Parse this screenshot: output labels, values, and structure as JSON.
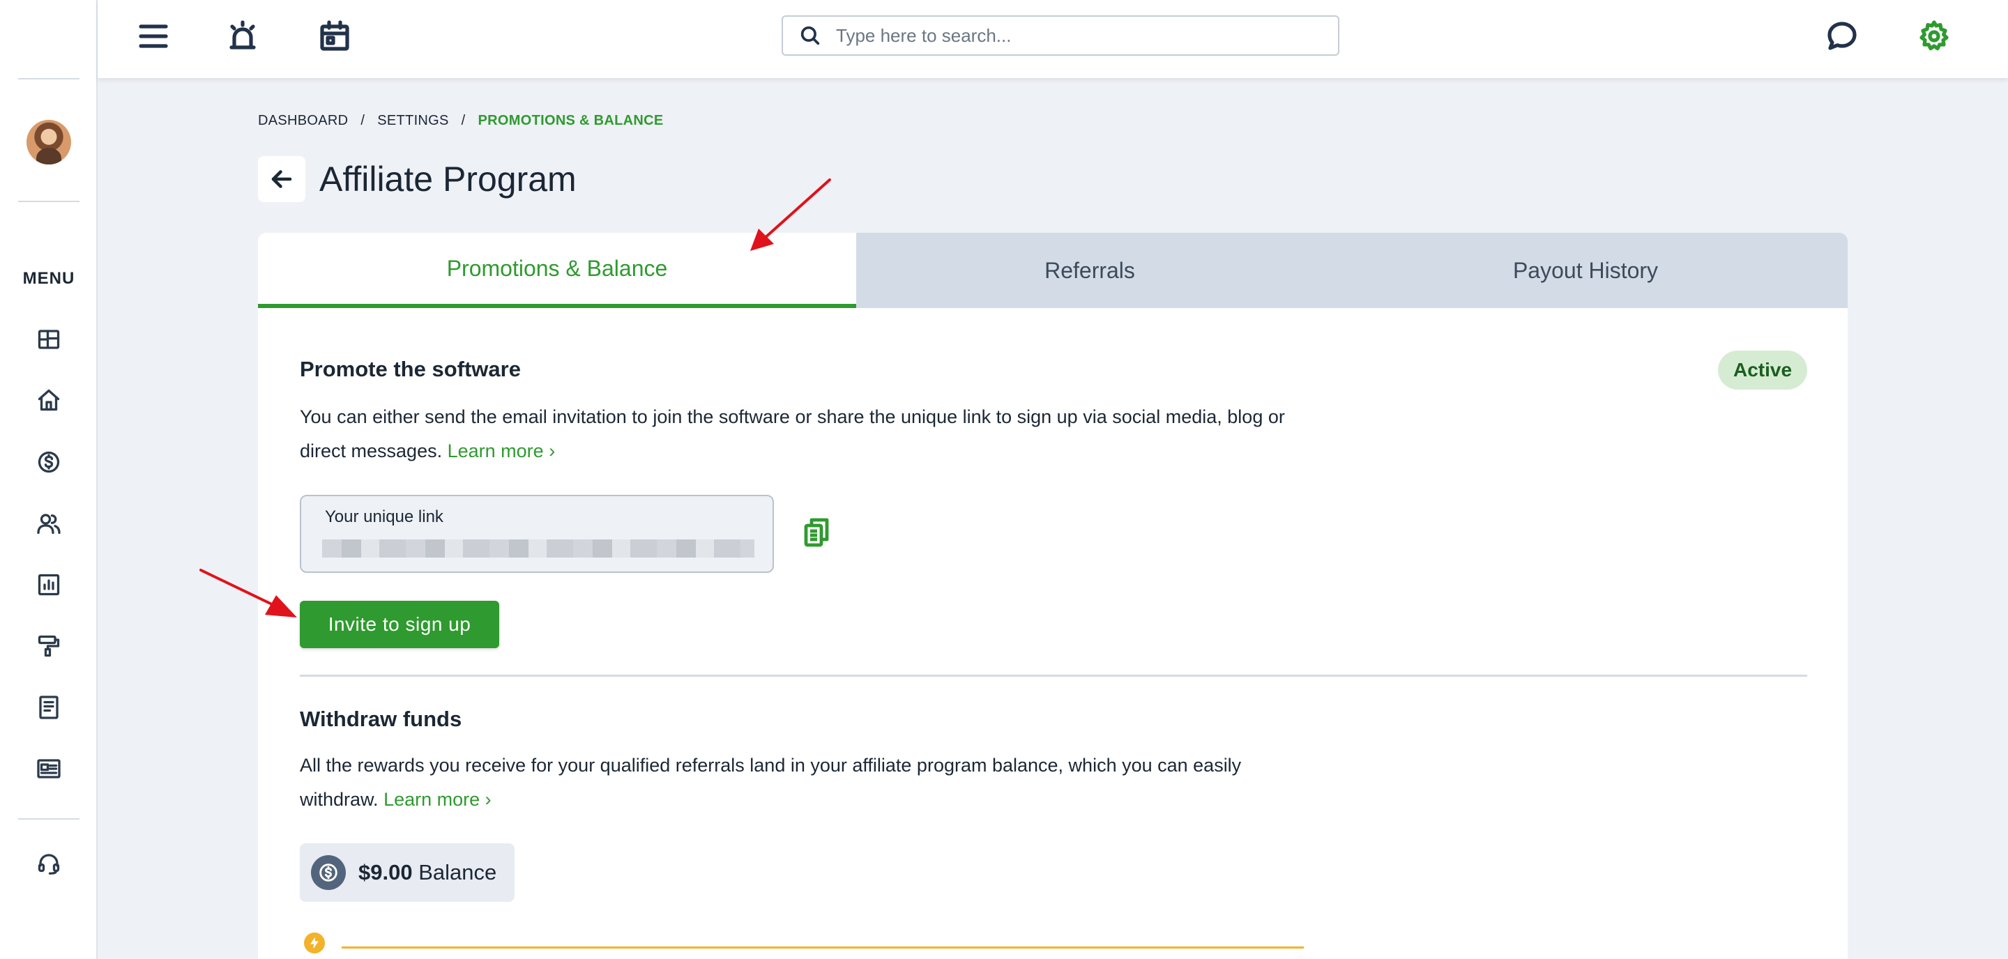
{
  "sidebar": {
    "menu_label": "MENU",
    "items": [
      {
        "name": "dashboard",
        "icon": "dashboard-icon"
      },
      {
        "name": "home",
        "icon": "home-icon"
      },
      {
        "name": "billing",
        "icon": "dollar-circle-icon"
      },
      {
        "name": "customers",
        "icon": "users-icon"
      },
      {
        "name": "reports",
        "icon": "bar-chart-icon"
      },
      {
        "name": "marketing",
        "icon": "paint-roller-icon"
      },
      {
        "name": "documents",
        "icon": "document-icon"
      },
      {
        "name": "forms",
        "icon": "id-card-icon"
      }
    ],
    "support_icon": "headset-icon"
  },
  "topbar": {
    "search_placeholder": "Type here to search...",
    "icons": [
      "menu-icon",
      "alarm-icon",
      "calendar-icon",
      "chat-icon",
      "gear-icon"
    ],
    "gear_color": "#2f9a2f"
  },
  "breadcrumb": {
    "items": [
      "DASHBOARD",
      "SETTINGS",
      "PROMOTIONS & BALANCE"
    ],
    "separator": "/"
  },
  "page": {
    "title": "Affiliate Program"
  },
  "tabs": [
    {
      "label": "Promotions & Balance",
      "active": true
    },
    {
      "label": "Referrals",
      "active": false
    },
    {
      "label": "Payout History",
      "active": false
    }
  ],
  "promote": {
    "title": "Promote the software",
    "status": "Active",
    "description": "You can either send the email invitation to join the software or share the unique link to sign up via social media, blog or direct messages.",
    "learn_more": "Learn more",
    "link_label": "Your unique link",
    "invite_button": "Invite to sign up"
  },
  "withdraw": {
    "title": "Withdraw funds",
    "description": "All the rewards you receive for your qualified referrals land in your affiliate program balance, which you can easily withdraw.",
    "learn_more": "Learn more",
    "balance_amount": "$9.00",
    "balance_label": "Balance"
  },
  "colors": {
    "accent": "#2f9a2f",
    "active_badge_bg": "#d5ecd2",
    "annotation_arrow": "#e0121b",
    "progress": "#f2b32a"
  }
}
